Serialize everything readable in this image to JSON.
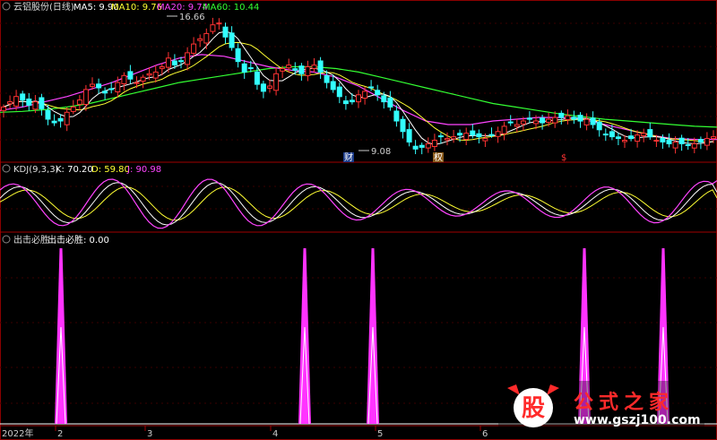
{
  "title_bar": {
    "stock_name": "云铝股份(日线)",
    "ma5": "MA5: 9.90",
    "ma10": "MA10: 9.76",
    "ma20": "MA20: 9.74",
    "ma60": "MA60: 10.44",
    "colors": {
      "ma5": "#ffffff",
      "ma10": "#ffff33",
      "ma20": "#ff44ff",
      "ma60": "#33ff33"
    }
  },
  "price_panel": {
    "high_label": "16.66",
    "low_label": "9.08",
    "event_markers": [
      "财",
      "权",
      "$"
    ]
  },
  "kdj_panel": {
    "name": "KDJ(9,3,3)",
    "k": "K: 70.20",
    "d": "D: 59.80",
    "j": "J: 90.98",
    "colors": {
      "k": "#ffffff",
      "d": "#ffff33",
      "j": "#ff44ff"
    }
  },
  "signal_panel": {
    "name": "出击必胜",
    "value_label": "出击必胜: 0.00",
    "color": "#ff33ff"
  },
  "x_axis": {
    "year_label": "2022年",
    "month_labels": [
      "2",
      "3",
      "4",
      "5",
      "6"
    ]
  },
  "watermark": {
    "logo_char": "股",
    "title": "公式之家",
    "url": "www.gszj100.com"
  },
  "chart_data": {
    "type": "candlestick",
    "period": "daily",
    "price_range": [
      9.08,
      16.66
    ],
    "annotations": {
      "high": 16.66,
      "low": 9.08
    },
    "ma_latest": {
      "MA5": 9.9,
      "MA10": 9.76,
      "MA20": 9.74,
      "MA60": 10.44
    },
    "price_path": [
      11.6,
      11.9,
      12.2,
      12.0,
      11.7,
      11.9,
      11.5,
      10.9,
      10.7,
      10.8,
      11.3,
      11.6,
      12.0,
      12.6,
      12.9,
      12.7,
      12.4,
      12.6,
      13.0,
      13.4,
      13.2,
      13.0,
      13.3,
      13.5,
      13.6,
      13.9,
      14.4,
      14.0,
      14.2,
      14.7,
      15.2,
      15.5,
      15.8,
      16.3,
      16.4,
      15.6,
      15.0,
      14.2,
      13.6,
      13.8,
      12.9,
      12.5,
      12.8,
      13.5,
      13.8,
      14.0,
      13.7,
      13.5,
      13.9,
      14.0,
      13.6,
      13.0,
      12.6,
      12.2,
      11.8,
      11.9,
      12.3,
      12.5,
      12.7,
      12.3,
      11.9,
      11.6,
      10.8,
      10.2,
      9.6,
      9.2,
      9.3,
      9.5,
      9.7,
      9.9,
      9.8,
      9.9,
      10.0,
      10.1,
      10.0,
      9.9,
      9.8,
      10.0,
      10.2,
      10.5,
      10.7,
      10.6,
      10.8,
      10.9,
      10.8,
      10.7,
      10.9,
      11.0,
      11.0,
      11.1,
      10.9,
      10.8,
      10.9,
      10.6,
      10.3,
      10.0,
      9.9,
      9.8,
      9.7,
      9.8,
      10.0,
      10.1,
      9.9,
      9.7,
      9.6,
      9.5,
      9.6,
      9.5,
      9.4,
      9.5,
      9.6,
      9.8,
      9.9
    ],
    "ma_paths": {
      "MA60": [
        11.3,
        11.35,
        11.45,
        11.6,
        11.8,
        12.1,
        12.4,
        12.7,
        13.0,
        13.2,
        13.4,
        13.6,
        13.8,
        13.9,
        13.9,
        13.8,
        13.6,
        13.3,
        13.0,
        12.7,
        12.4,
        12.1,
        11.8,
        11.6,
        11.4,
        11.2,
        11.05,
        10.9,
        10.8,
        10.7,
        10.6,
        10.5,
        10.45
      ],
      "MA20": [
        11.4,
        11.6,
        11.9,
        12.2,
        12.6,
        13.0,
        13.5,
        14.0,
        14.4,
        14.6,
        14.5,
        14.2,
        13.9,
        13.7,
        13.6,
        13.3,
        12.8,
        12.1,
        11.4,
        10.8,
        10.6,
        10.6,
        10.8,
        10.9,
        11.0,
        11.0,
        10.9,
        10.6,
        10.3,
        10.0,
        9.8,
        9.75,
        9.74
      ]
    },
    "kdj": {
      "K": 70.2,
      "D": 59.8,
      "J": 90.98
    },
    "signal": {
      "latest": 0.0,
      "spike_positions": [
        0.085,
        0.425,
        0.52,
        0.815,
        0.925
      ]
    }
  }
}
